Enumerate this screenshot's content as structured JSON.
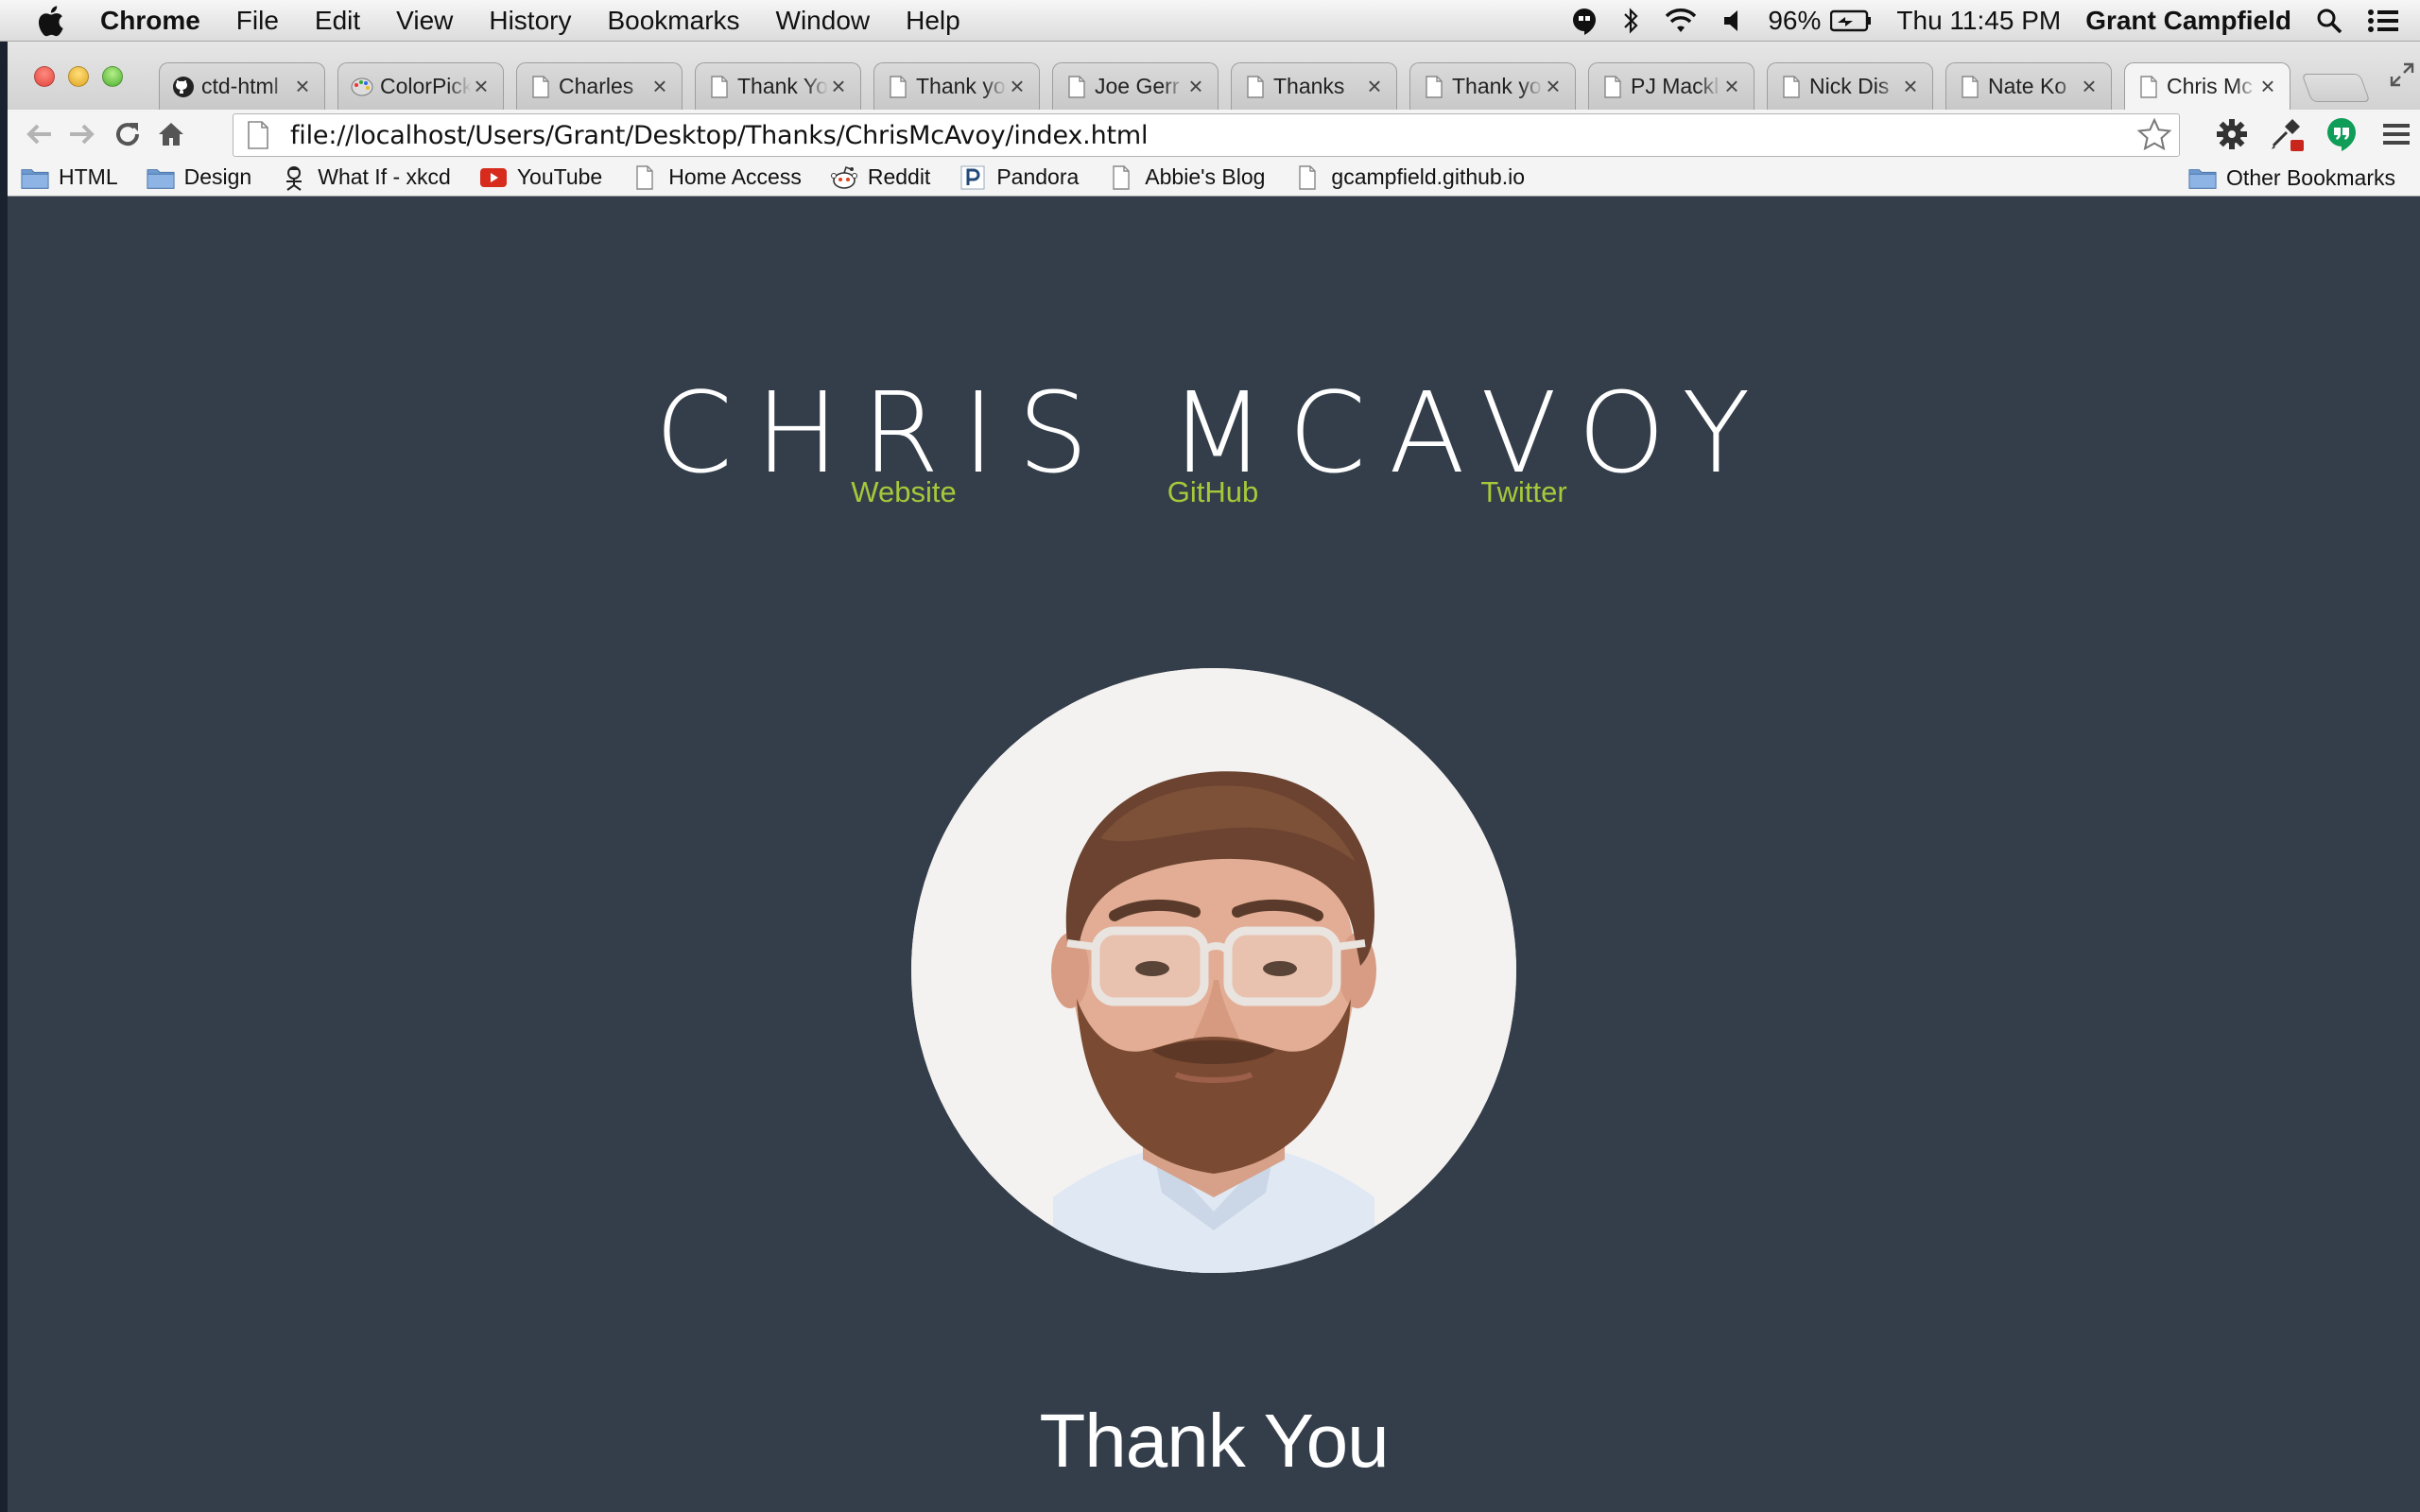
{
  "menubar": {
    "app_name": "Chrome",
    "items": [
      "File",
      "Edit",
      "View",
      "History",
      "Bookmarks",
      "Window",
      "Help"
    ],
    "battery": "96%",
    "clock": "Thu 11:45 PM",
    "user": "Grant Campfield"
  },
  "tabs": [
    {
      "title": "ctd-html",
      "icon": "github-icon",
      "active": false
    },
    {
      "title": "ColorPicker",
      "icon": "palette-icon",
      "active": false
    },
    {
      "title": "Charles",
      "icon": "page-icon",
      "active": false
    },
    {
      "title": "Thank You",
      "icon": "page-icon",
      "active": false
    },
    {
      "title": "Thank you",
      "icon": "page-icon",
      "active": false
    },
    {
      "title": "Joe Gerr",
      "icon": "page-icon",
      "active": false
    },
    {
      "title": "Thanks",
      "icon": "page-icon",
      "active": false
    },
    {
      "title": "Thank you",
      "icon": "page-icon",
      "active": false
    },
    {
      "title": "PJ Mackl",
      "icon": "page-icon",
      "active": false
    },
    {
      "title": "Nick Dis",
      "icon": "page-icon",
      "active": false
    },
    {
      "title": "Nate Ko",
      "icon": "page-icon",
      "active": false
    },
    {
      "title": "Chris Mc",
      "icon": "page-icon",
      "active": true
    }
  ],
  "toolbar": {
    "url": "file://localhost/Users/Grant/Desktop/Thanks/ChrisMcAvoy/index.html"
  },
  "bookmarks": [
    {
      "label": "HTML",
      "icon": "folder-icon"
    },
    {
      "label": "Design",
      "icon": "folder-icon"
    },
    {
      "label": "What If - xkcd",
      "icon": "xkcd-icon"
    },
    {
      "label": "YouTube",
      "icon": "youtube-icon"
    },
    {
      "label": "Home Access",
      "icon": "page-icon"
    },
    {
      "label": "Reddit",
      "icon": "reddit-icon"
    },
    {
      "label": "Pandora",
      "icon": "pandora-icon"
    },
    {
      "label": "Abbie's Blog",
      "icon": "page-icon"
    },
    {
      "label": "gcampfield.github.io",
      "icon": "page-icon"
    }
  ],
  "other_bookmarks": "Other Bookmarks",
  "page": {
    "name": "CHRIS MCAVOY",
    "links": [
      "Website",
      "GitHub",
      "Twitter"
    ],
    "thanks": "Thank You",
    "link_color": "#a5c93a",
    "background": "#333e4a"
  }
}
